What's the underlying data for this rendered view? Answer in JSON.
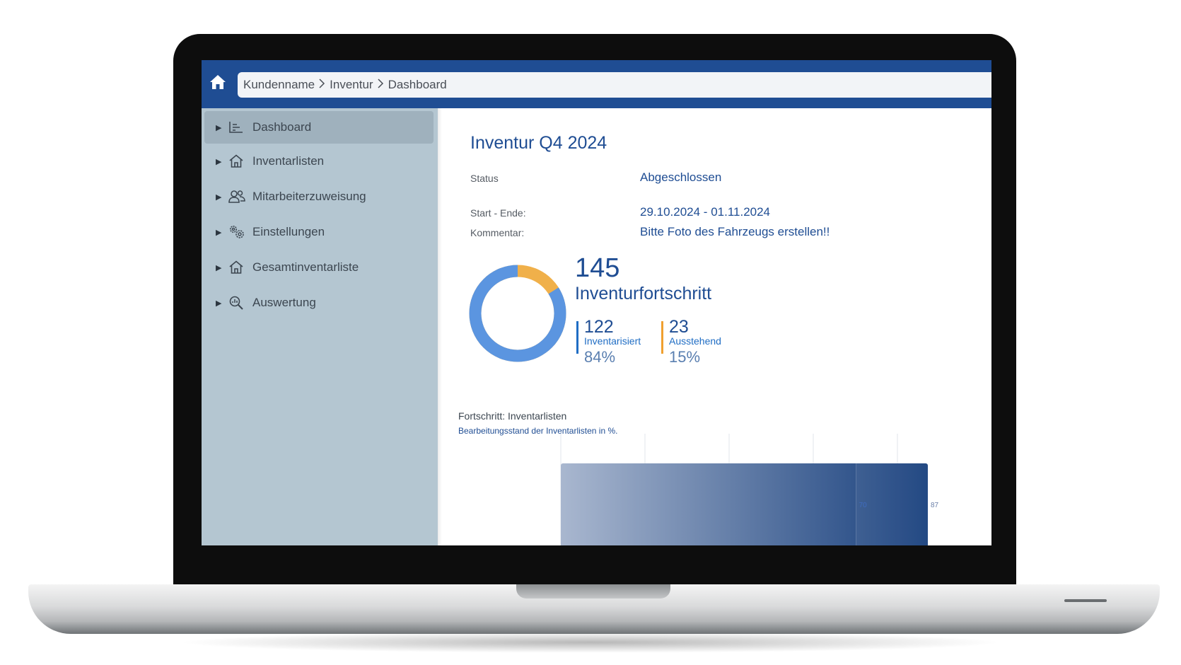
{
  "breadcrumb": [
    "Kundenname",
    "Inventur",
    "Dashboard"
  ],
  "sidebar": {
    "items": [
      {
        "label": "Dashboard",
        "icon": "bar-list-icon",
        "active": true
      },
      {
        "label": "Inventarlisten",
        "icon": "house-icon"
      },
      {
        "label": "Mitarbeiterzuweisung",
        "icon": "users-icon"
      },
      {
        "label": "Einstellungen",
        "icon": "gears-icon"
      },
      {
        "label": "Gesamtinventarliste",
        "icon": "house-icon"
      },
      {
        "label": "Auswertung",
        "icon": "magnifier-chart-icon"
      }
    ]
  },
  "main": {
    "title": "Inventur Q4 2024",
    "status_label": "Status",
    "status_value": "Abgeschlossen",
    "period_label": "Start - Ende:",
    "period_value": "29.10.2024 - 01.11.2024",
    "comment_label": "Kommentar:",
    "comment_value": "Bitte Foto des Fahrzeugs erstellen!!"
  },
  "progress": {
    "total": "145",
    "label": "Inventurfortschritt",
    "done_count": "122",
    "done_label": "Inventarisiert",
    "done_pct": "84%",
    "pending_count": "23",
    "pending_label": "Ausstehend",
    "pending_pct": "15%",
    "done_fraction": 0.84,
    "colors": {
      "done": "#5b95e0",
      "pending": "#f0b04a",
      "done_bar": "#1f6dc4",
      "pending_bar": "#f0a030"
    }
  },
  "chart_data": {
    "type": "bar",
    "title": "Fortschritt: Inventarlisten",
    "subtitle": "Bearbeitungsstand der Inventarlisten in %.",
    "series": [
      {
        "values": [
          70,
          87
        ]
      }
    ],
    "data_labels": [
      "70",
      "87"
    ],
    "colors": {
      "start": "#a9b7cf",
      "end": "#163e7c"
    }
  },
  "colors": {
    "topbar": "#1f4d93",
    "sidebar": "#b4c6d1",
    "accent": "#1f4d93"
  }
}
